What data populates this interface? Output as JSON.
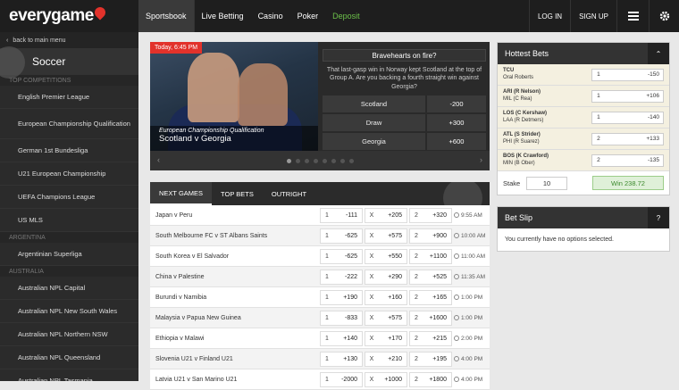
{
  "brand": {
    "logo": "everygame"
  },
  "nav": {
    "items": [
      {
        "label": "Sportsbook"
      },
      {
        "label": "Live Betting"
      },
      {
        "label": "Casino"
      },
      {
        "label": "Poker"
      },
      {
        "label": "Deposit"
      }
    ],
    "login": "LOG IN",
    "signup": "SIGN UP"
  },
  "sidebar": {
    "back": "back to main menu",
    "sport": "Soccer",
    "cat_top": "TOP COMPETITIONS",
    "cat_arg": "ARGENTINA",
    "cat_aus": "AUSTRALIA",
    "items": [
      "English Premier League",
      "European Championship Qualification",
      "German 1st Bundesliga",
      "U21 European Championship",
      "UEFA Champions League",
      "US MLS",
      "Argentinian Superliga",
      "Australian NPL Capital",
      "Australian NPL New South Wales",
      "Australian NPL Northern NSW",
      "Australian NPL Queensland",
      "Australian NPL Tasmania"
    ]
  },
  "hero": {
    "date": "Today, 6:45 PM",
    "competition": "European Championship Qualification",
    "match": "Scotland v Georgia",
    "promo_title": "Bravehearts on fire?",
    "promo_text": "That last-gasp win in Norway kept Scotland at the top of Group A. Are you backing a fourth straight win against Georgia?",
    "odds": [
      {
        "label": "Scotland",
        "odd": "-200"
      },
      {
        "label": "Draw",
        "odd": "+300"
      },
      {
        "label": "Georgia",
        "odd": "+600"
      }
    ]
  },
  "tabs": [
    "NEXT GAMES",
    "TOP BETS",
    "OUTRIGHT"
  ],
  "games": [
    {
      "name": "Japan v Peru",
      "o1": "-111",
      "ox": "+205",
      "o2": "+320",
      "time": "9:55 AM"
    },
    {
      "name": "South Melbourne FC v ST Albans Saints",
      "o1": "-625",
      "ox": "+575",
      "o2": "+900",
      "time": "10:00 AM"
    },
    {
      "name": "South Korea v El Salvador",
      "o1": "-625",
      "ox": "+550",
      "o2": "+1100",
      "time": "11:00 AM"
    },
    {
      "name": "China v Palestine",
      "o1": "-222",
      "ox": "+290",
      "o2": "+525",
      "time": "11:35 AM"
    },
    {
      "name": "Burundi v Namibia",
      "o1": "+190",
      "ox": "+160",
      "o2": "+165",
      "time": "1:00 PM"
    },
    {
      "name": "Malaysia v Papua New Guinea",
      "o1": "-833",
      "ox": "+575",
      "o2": "+1600",
      "time": "1:00 PM"
    },
    {
      "name": "Ethiopia v Malawi",
      "o1": "+140",
      "ox": "+170",
      "o2": "+215",
      "time": "2:00 PM"
    },
    {
      "name": "Slovenia U21 v Finland U21",
      "o1": "+130",
      "ox": "+210",
      "o2": "+195",
      "time": "4:00 PM"
    },
    {
      "name": "Latvia U21 v San Marino U21",
      "o1": "-2000",
      "ox": "+1000",
      "o2": "+1800",
      "time": "4:00 PM"
    }
  ],
  "odds_keys": {
    "home": "1",
    "draw": "X",
    "away": "2"
  },
  "hottest": {
    "title": "Hottest Bets",
    "bets": [
      {
        "l1": "TCU",
        "l2": "Oral Roberts",
        "k": "1",
        "odd": "-150"
      },
      {
        "l1": "ARI (R Nelson)",
        "l2": "MIL (C Rea)",
        "k": "1",
        "odd": "+106"
      },
      {
        "l1": "LOS (C Kershaw)",
        "l2": "LAA (R Detmers)",
        "k": "1",
        "odd": "-140"
      },
      {
        "l1": "ATL (S Strider)",
        "l2": "PHI (R Suarez)",
        "k": "2",
        "odd": "+133"
      },
      {
        "l1": "BOS (K Crawford)",
        "l2": "MIN (B Ober)",
        "k": "2",
        "odd": "-135"
      }
    ],
    "stake_label": "Stake",
    "stake_value": "10",
    "win": "Win 238.72"
  },
  "betslip": {
    "title": "Bet Slip",
    "help": "?",
    "empty": "You currently have no options selected."
  },
  "colors": {
    "accent": "#e2322b",
    "deposit": "#6cc04a",
    "dark": "#1e1e1e"
  }
}
